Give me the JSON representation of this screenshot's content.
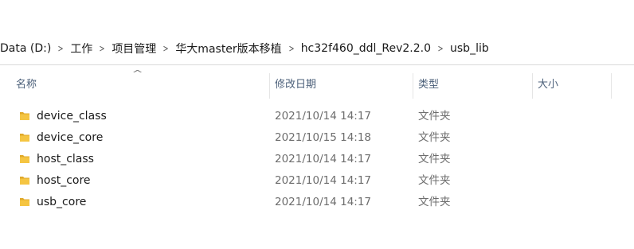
{
  "breadcrumb": {
    "items": [
      "Data (D:)",
      "工作",
      "项目管理",
      "华大master版本移植",
      "hc32f460_ddl_Rev2.2.0",
      "usb_lib"
    ]
  },
  "columns": {
    "name": "名称",
    "date": "修改日期",
    "type": "类型",
    "size": "大小"
  },
  "sort_indicator": "^",
  "files": [
    {
      "name": "device_class",
      "date": "2021/10/14 14:17",
      "type": "文件夹",
      "icon": "folder-icon"
    },
    {
      "name": "device_core",
      "date": "2021/10/15 14:18",
      "type": "文件夹",
      "icon": "folder-icon"
    },
    {
      "name": "host_class",
      "date": "2021/10/14 14:17",
      "type": "文件夹",
      "icon": "folder-icon"
    },
    {
      "name": "host_core",
      "date": "2021/10/14 14:17",
      "type": "文件夹",
      "icon": "folder-icon"
    },
    {
      "name": "usb_core",
      "date": "2021/10/14 14:17",
      "type": "文件夹",
      "icon": "folder-icon"
    }
  ],
  "colors": {
    "folder": "#f5c542",
    "folder_dark": "#e0a92a",
    "header_text": "#4c607a"
  }
}
